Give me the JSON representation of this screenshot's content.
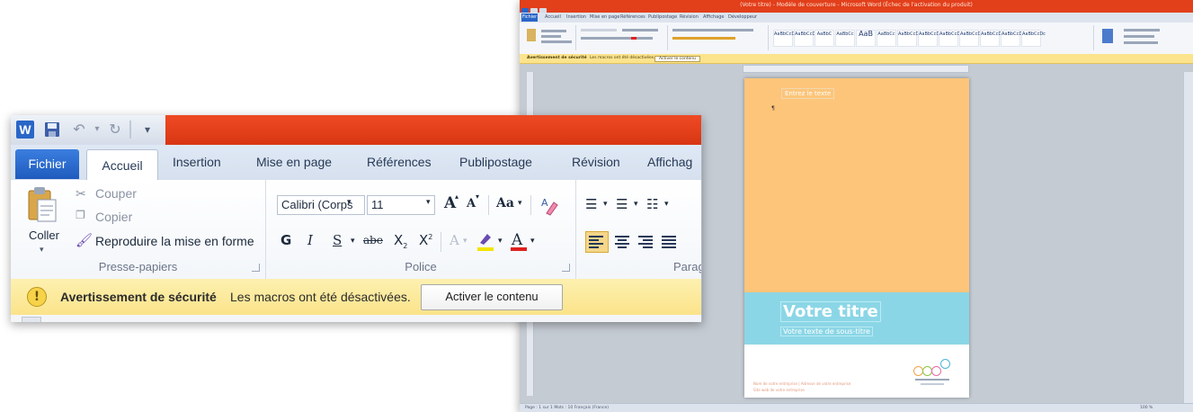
{
  "bg_window": {
    "title": "(Votre titre) - Modèle de couverture - Microsoft Word (Échec de l'activation du produit)",
    "tabs": [
      "Fichier",
      "Accueil",
      "Insertion",
      "Mise en page",
      "Références",
      "Publipostage",
      "Révision",
      "Affichage",
      "Développeur"
    ],
    "styles": [
      "AaBbCcDc",
      "AaBbCcDc",
      "AaBbC",
      "AaBbCc",
      "AaB",
      "AaBbCc",
      "AaBbCcDc",
      "AaBbCcDc",
      "AaBbCcDc",
      "AaBbCcDc",
      "AaBbCcDc",
      "AaBbCcDc",
      "AaBbCcDc"
    ],
    "warning_title": "Avertissement de sécurité",
    "warning_msg": "Les macros ont été désactivées.",
    "warning_btn": "Activer le contenu",
    "status_left": "Page : 1 sur 1   Mots : 10   Français (France)",
    "status_right": "100 %",
    "page": {
      "tag": "Entrez le texte",
      "cursor": "¶",
      "title": "Votre titre",
      "subtitle": "Votre texte de sous-titre",
      "footer_line1": "Nom de votre entreprise | Adresse de votre entreprise",
      "footer_line2": "Site web de votre entreprise",
      "logo_colors": [
        "#f4a24a",
        "#8cc63f",
        "#e86aa4",
        "#49b8d8"
      ]
    }
  },
  "zoom": {
    "tabs": {
      "file": "Fichier",
      "home": "Accueil",
      "insert": "Insertion",
      "layout": "Mise en page",
      "references": "Références",
      "mailings": "Publipostage",
      "review": "Révision",
      "view": "Affichag"
    },
    "clipboard": {
      "paste": "Coller",
      "cut": "Couper",
      "copy": "Copier",
      "format_painter": "Reproduire la mise en forme",
      "label": "Presse-papiers"
    },
    "font": {
      "name": "Calibri (Corps",
      "size": "11",
      "grow": "A",
      "shrink": "A",
      "case": "Aa",
      "bold": "G",
      "italic": "I",
      "underline": "S",
      "strike": "abe",
      "subscript": "X",
      "superscript": "X",
      "label": "Police"
    },
    "paragraph": {
      "label": "Paragr"
    },
    "warning": {
      "title": "Avertissement de sécurité",
      "message": "Les macros ont été désactivées.",
      "button": "Activer le contenu"
    },
    "colors": {
      "title_bar": "#e23f1b",
      "file_tab": "#2a66c7",
      "warning_bg": "#fce48e",
      "highlight": "#f4e400",
      "font_color": "#e02020"
    }
  }
}
